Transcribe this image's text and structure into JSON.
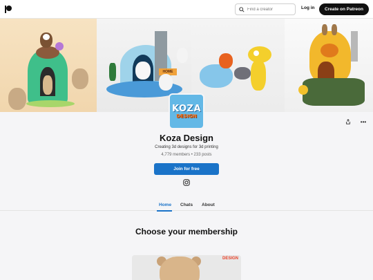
{
  "topbar": {
    "search_placeholder": "Find a creator",
    "login_label": "Log in",
    "create_label": "Create on Patreon"
  },
  "banner": {
    "panels": [
      "colorful-3d-printed-figures",
      "igloo-polar-bear-figures",
      "articulated-animal-toys",
      "beehive-house-figure"
    ],
    "sign_text": "HOME"
  },
  "creator": {
    "avatar_line1": "KOZA",
    "avatar_line2": "DESIGN",
    "name": "Koza Design",
    "tagline": "Creating 3d designs for 3d printing",
    "stats": "4,779 members  •  233 posts",
    "join_label": "Join for free"
  },
  "tabs": [
    {
      "label": "Home",
      "active": true
    },
    {
      "label": "Chats",
      "active": false
    },
    {
      "label": "About",
      "active": false
    }
  ],
  "membership": {
    "heading": "Choose your membership",
    "card_label": "DESIGN"
  },
  "colors": {
    "brand_blue": "#1a73c8",
    "avatar_bg": "#63b8e6",
    "dark": "#111111"
  }
}
